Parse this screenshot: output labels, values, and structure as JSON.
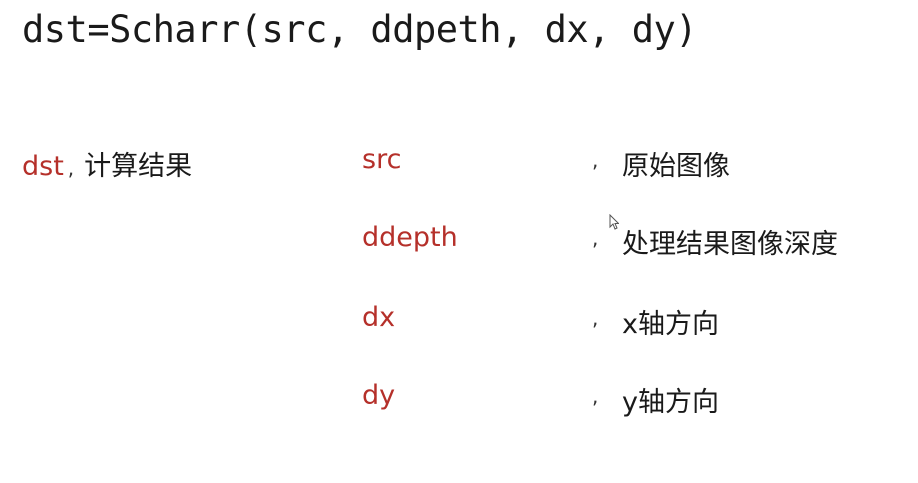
{
  "formula": "dst=Scharr(src, ddpeth, dx, dy)",
  "return_value": {
    "term": "dst",
    "separator": ",",
    "description": "计算结果"
  },
  "params": [
    {
      "name": "src",
      "separator": ",",
      "description": "原始图像"
    },
    {
      "name": "ddepth",
      "separator": ",",
      "description": "处理结果图像深度"
    },
    {
      "name": "dx",
      "separator": ",",
      "description": "x轴方向"
    },
    {
      "name": "dy",
      "separator": ",",
      "description": "y轴方向"
    }
  ],
  "colors": {
    "term": "#b5302a",
    "text": "#1a1a1a"
  },
  "cursor_icon": "mouse-pointer-icon"
}
